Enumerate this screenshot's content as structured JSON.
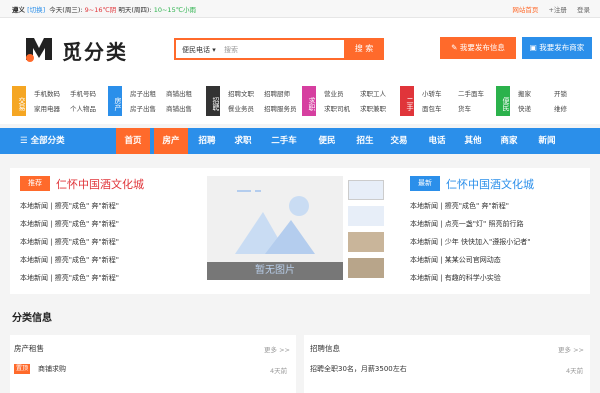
{
  "topbar": {
    "city": "遵义",
    "switch": "[切换]",
    "today": "今天(周三):",
    "today_temp": "9~16℃阴",
    "tomorrow": "明天(周四):",
    "tomorrow_temp": "10~15℃小雨",
    "home": "网站首页",
    "register": "+注册",
    "login": "登录"
  },
  "header": {
    "logo_text": "觅分类",
    "search_category": "便民电话",
    "search_placeholder": "搜索",
    "search_button": "搜 索",
    "publish_info": "我要发布信息",
    "publish_merchant": "我要发布商家"
  },
  "categories": [
    {
      "tag": "交易",
      "color": "#f5a623",
      "items": [
        "手机数码",
        "手机号码",
        "家用电器",
        "个人物品"
      ]
    },
    {
      "tag": "房产",
      "color": "#2b8fea",
      "items": [
        "房子出租",
        "商铺出租",
        "房子出售",
        "商铺出售"
      ]
    },
    {
      "tag": "招聘",
      "color": "#333333",
      "items": [
        "招聘文职",
        "招聘厨师",
        "餐业务员",
        "招聘服务员"
      ]
    },
    {
      "tag": "求职",
      "color": "#d63fa0",
      "items": [
        "营业员",
        "求职工人",
        "求职司机",
        "求职兼职"
      ]
    },
    {
      "tag": "二手",
      "color": "#e0353a",
      "items": [
        "小轿车",
        "二手面车",
        "面包车",
        "货车"
      ]
    },
    {
      "tag": "便民",
      "color": "#2bb24c",
      "items": [
        "搬家",
        "开锁",
        "快递",
        "维修"
      ]
    }
  ],
  "nav": {
    "all": "全部分类",
    "items": [
      "首页",
      "房产",
      "招聘",
      "求职",
      "二手车",
      "便民",
      "招生",
      "交易",
      "电话",
      "其他",
      "商家",
      "新闻"
    ]
  },
  "recommend": {
    "badge": "推荐",
    "title": "仁怀中国酒文化城",
    "items": [
      "本地新闻 | 擦亮\"成色\" 奔\"新程\"",
      "本地新闻 | 擦亮\"成色\" 奔\"新程\"",
      "本地新闻 | 擦亮\"成色\" 奔\"新程\"",
      "本地新闻 | 擦亮\"成色\" 奔\"新程\"",
      "本地新闻 | 擦亮\"成色\" 奔\"新程\""
    ]
  },
  "slider": {
    "caption": "暂无图片"
  },
  "latest": {
    "badge": "最新",
    "title": "仁怀中国酒文化城",
    "items": [
      "本地新闻 | 擦亮\"成色\" 奔\"新程\"",
      "本地新闻 | 点亮一盏\"灯\" 照亮前行路",
      "本地新闻 | 少年 快快加入\"遵报小记者\"",
      "本地新闻 | 某某公司官网动态",
      "本地新闻 | 有趣的科学小实验"
    ]
  },
  "section": {
    "title": "分类信息"
  },
  "lists": {
    "left": {
      "title": "房产租售",
      "more": "更多 >>",
      "badge": "置顶",
      "first": "商铺求购",
      "time": "4天前"
    },
    "right": {
      "title": "招聘信息",
      "more": "更多 >>",
      "first": "招聘全职30名，月薪3500左右",
      "time": "4天前"
    }
  }
}
